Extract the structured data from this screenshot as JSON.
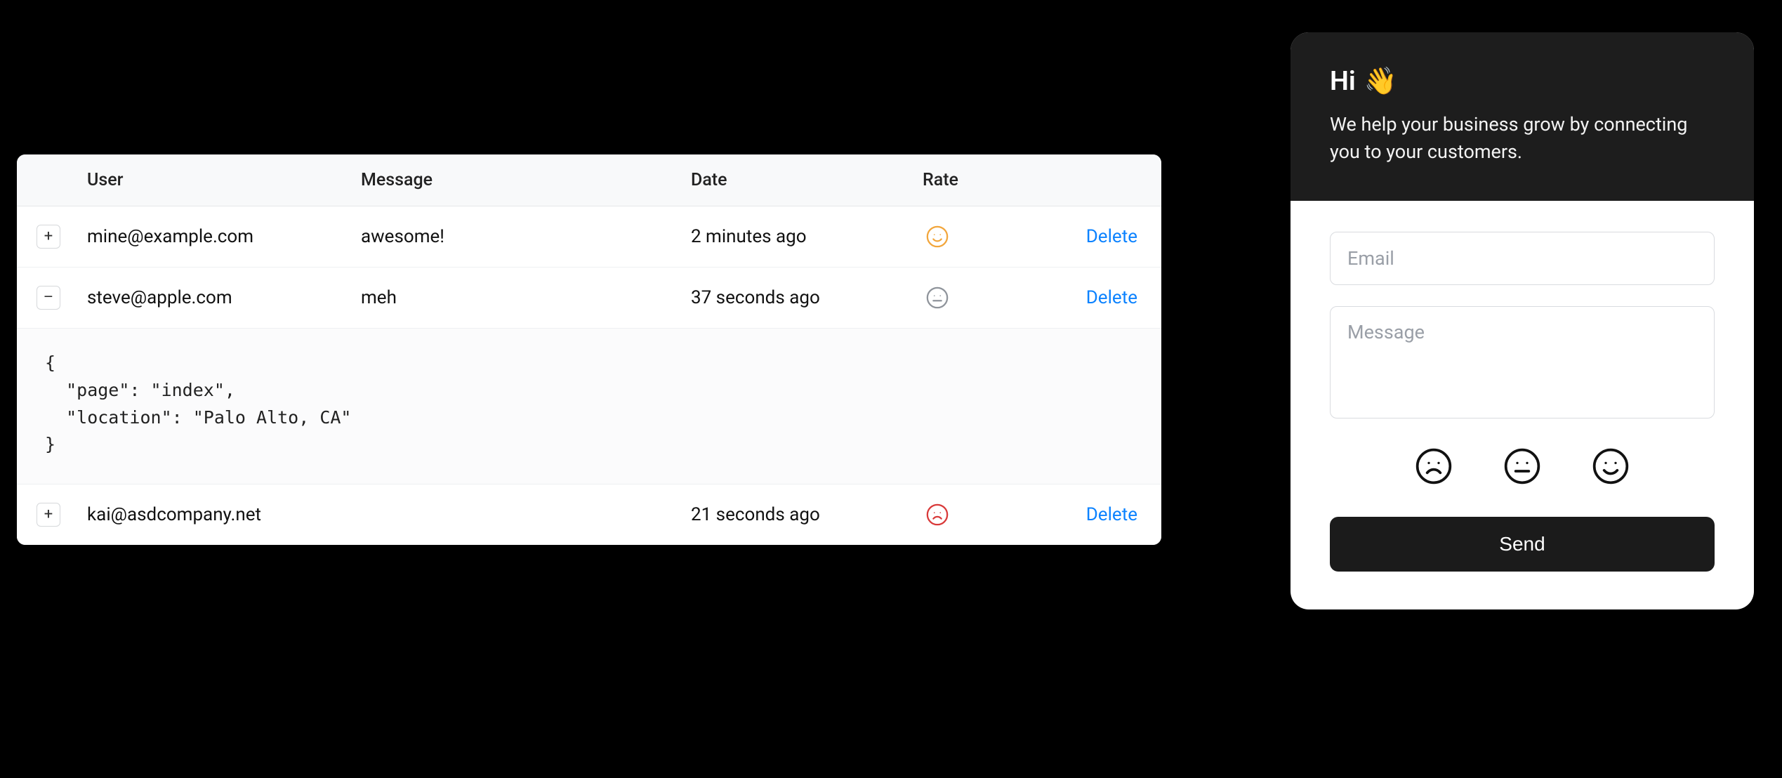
{
  "table": {
    "headers": {
      "user": "User",
      "message": "Message",
      "date": "Date",
      "rate": "Rate"
    },
    "rows": [
      {
        "expander": "+",
        "user": "mine@example.com",
        "message": "awesome!",
        "date": "2 minutes ago",
        "rate": "happy",
        "action": "Delete"
      },
      {
        "expander": "–",
        "user": "steve@apple.com",
        "message": "meh",
        "date": "37 seconds ago",
        "rate": "neutral",
        "action": "Delete",
        "detail": "{\n  \"page\": \"index\",\n  \"location\": \"Palo Alto, CA\"\n}"
      },
      {
        "expander": "+",
        "user": "kai@asdcompany.net",
        "message": "",
        "date": "21 seconds ago",
        "rate": "sad",
        "action": "Delete"
      }
    ]
  },
  "widget": {
    "greeting": "Hi",
    "emoji": "👋",
    "subtitle": "We help your business grow by connecting you to your customers.",
    "email_placeholder": "Email",
    "message_placeholder": "Message",
    "send_label": "Send"
  },
  "colors": {
    "rate_happy": "#f2a63c",
    "rate_neutral": "#8f949b",
    "rate_sad": "#d93a3a",
    "link": "#0b82ff",
    "widget_header_bg": "#1d1d1d"
  }
}
